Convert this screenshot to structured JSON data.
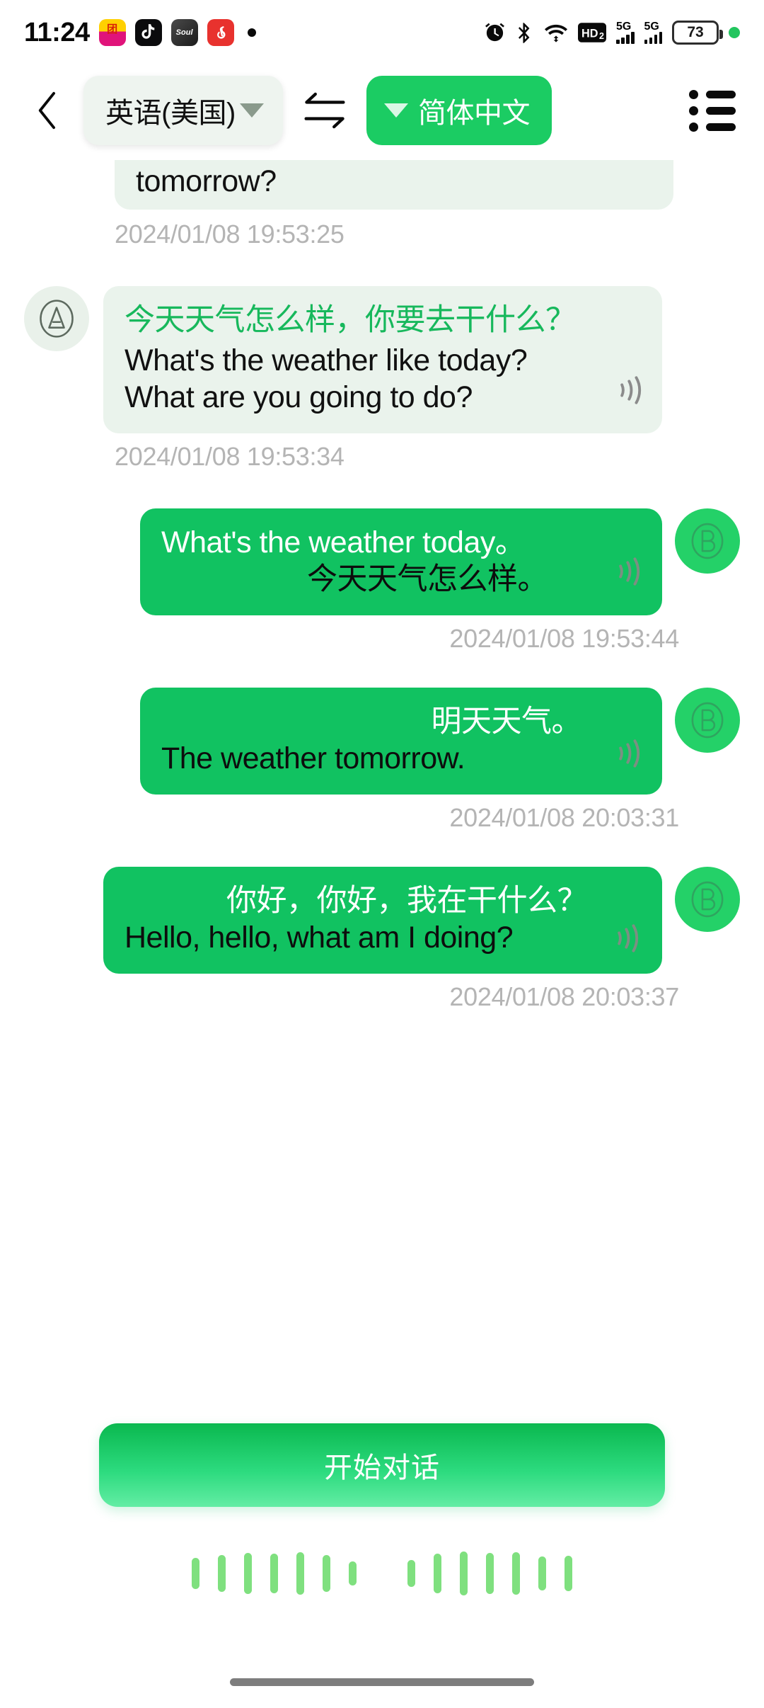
{
  "status_bar": {
    "time": "11:24",
    "app_icons": [
      {
        "name": "meituan-app-icon",
        "glyph": "美团"
      },
      {
        "name": "tiktok-app-icon",
        "glyph": "♪"
      },
      {
        "name": "soul-app-icon",
        "glyph": "Soul"
      },
      {
        "name": "netease-music-app-icon",
        "glyph": "♪"
      }
    ],
    "system_icons": [
      "alarm-icon",
      "bluetooth-icon",
      "wifi-icon",
      "hd-voice-icon",
      "signal-5g-icon-1",
      "signal-5g-icon-2"
    ],
    "network_label": "5G",
    "hd_label": "HD",
    "hd_sub": "2",
    "battery_percent": "73"
  },
  "header": {
    "back_icon": "back-chevron-icon",
    "source_language": "英语(美国)",
    "swap_icon": "swap-languages-icon",
    "target_language": "简体中文",
    "menu_icon": "list-menu-icon",
    "accent_green": "#1bcc63",
    "source_chip_bg": "#eef4ef"
  },
  "conversation": {
    "messages": [
      {
        "id": "msg-0",
        "side": "in",
        "clipped": true,
        "avatar": "",
        "lines": [
          {
            "text": "tomorrow?",
            "lang": "en",
            "color": "black"
          }
        ],
        "timestamp": "2024/01/08 19:53:25",
        "speaker_icon": "sound-wave-icon"
      },
      {
        "id": "msg-1",
        "side": "in",
        "clipped": false,
        "avatar": "A",
        "lines": [
          {
            "text": "今天天气怎么样，你要去干什么？",
            "lang": "zh",
            "color": "green"
          },
          {
            "text": "What's the weather like today? What are you going to do?",
            "lang": "en",
            "color": "black"
          }
        ],
        "timestamp": "2024/01/08 19:53:34",
        "speaker_icon": "sound-wave-icon"
      },
      {
        "id": "msg-2",
        "side": "out",
        "clipped": false,
        "avatar": "B",
        "lines": [
          {
            "text": "What's the weather today。",
            "lang": "en",
            "color": "white"
          },
          {
            "text": "今天天气怎么样。",
            "lang": "zh",
            "color": "black"
          }
        ],
        "timestamp": "2024/01/08 19:53:44",
        "speaker_icon": "sound-wave-icon"
      },
      {
        "id": "msg-3",
        "side": "out",
        "clipped": false,
        "avatar": "B",
        "lines": [
          {
            "text": "明天天气。",
            "lang": "zh",
            "color": "white"
          },
          {
            "text": "The weather tomorrow.",
            "lang": "en",
            "color": "black"
          }
        ],
        "timestamp": "2024/01/08 20:03:31",
        "speaker_icon": "sound-wave-icon"
      },
      {
        "id": "msg-4",
        "side": "out",
        "clipped": false,
        "avatar": "B",
        "lines": [
          {
            "text": "你好，你好，我在干什么？",
            "lang": "zh",
            "color": "white"
          },
          {
            "text": "Hello, hello, what am I doing?",
            "lang": "en",
            "color": "black"
          }
        ],
        "timestamp": "2024/01/08 20:03:37",
        "speaker_icon": "sound-wave-icon"
      }
    ]
  },
  "footer": {
    "start_button_label": "开始对话",
    "waveform_icon": "audio-waveform-icon",
    "waveform_groups": [
      [
        44,
        52,
        58,
        56,
        60,
        52,
        34
      ],
      [
        38,
        56,
        62,
        58,
        60,
        48,
        50
      ]
    ],
    "wave_color": "#7fe07f",
    "home_indicator": "home-indicator"
  }
}
